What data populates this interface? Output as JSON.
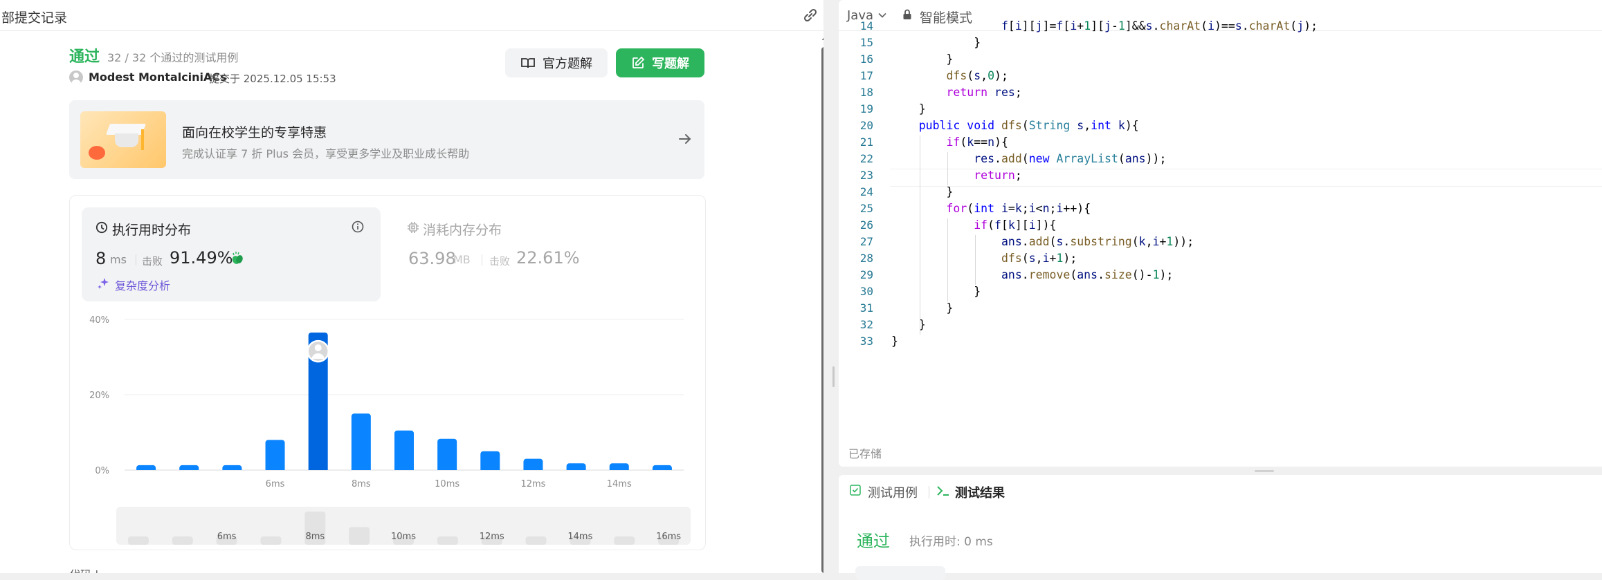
{
  "left_panel": {
    "title": "部提交记录",
    "status": "通过",
    "status_sub": "32 / 32 个通过的测试用例",
    "user_name": "Modest MontalciniACs",
    "submit_time": "提交于 2025.12.05 15:53",
    "btn_official": "官方题解",
    "btn_write": "写题解",
    "bottom_cut": "代码 | ..."
  },
  "promo": {
    "title": "面向在校学生的专享特惠",
    "subtitle": "完成认证享 7 折 Plus 会员，享受更多学业及职业成长帮助"
  },
  "runtime": {
    "title": "执行用时分布",
    "value": "8",
    "unit": "ms",
    "beat_label": "击败",
    "beat_pct": "91.49%",
    "complexity_link": "复杂度分析"
  },
  "memory": {
    "title": "消耗内存分布",
    "value": "63.98",
    "unit": "MB",
    "beat_label": "击败",
    "beat_pct": "22.61%"
  },
  "chart_data": {
    "type": "bar",
    "title": "",
    "xlabel": "",
    "ylabel": "",
    "ylim": [
      0,
      40
    ],
    "y_ticks": [
      "0%",
      "20%",
      "40%"
    ],
    "x_tick_labels": [
      {
        "index": 3,
        "label": "6ms"
      },
      {
        "index": 5,
        "label": "8ms"
      },
      {
        "index": 7,
        "label": "10ms"
      },
      {
        "index": 9,
        "label": "12ms"
      },
      {
        "index": 11,
        "label": "14ms"
      },
      {
        "index": 13,
        "label": "16ms"
      }
    ],
    "values": [
      1.3,
      1.3,
      1.3,
      8,
      36.5,
      15,
      10.5,
      8.3,
      5,
      3,
      1.8,
      1.8,
      1.3
    ],
    "highlight_index": 4,
    "grid": true,
    "accent": "#0a84ff",
    "accent_dark": "#0066e0",
    "mini_values": [
      1,
      1,
      1,
      1,
      5,
      2.5,
      1,
      1,
      1,
      1,
      1,
      1,
      1
    ],
    "mini_labels": [
      {
        "index": 2,
        "label": "6ms"
      },
      {
        "index": 4,
        "label": "8ms"
      },
      {
        "index": 6,
        "label": "10ms"
      },
      {
        "index": 8,
        "label": "12ms"
      },
      {
        "index": 10,
        "label": "14ms"
      },
      {
        "index": 12,
        "label": "16ms"
      }
    ]
  },
  "editor": {
    "language": "Java",
    "mode": "智能模式",
    "saved": "已存储",
    "current_line": 23,
    "lines": [
      {
        "n": "14",
        "html": "                f[i][j]=f[i+1][j-1]&&s.charAt(i)==s.charAt(j);"
      },
      {
        "n": "15",
        "html": "            }"
      },
      {
        "n": "16",
        "html": "        }"
      },
      {
        "n": "17",
        "html": "        dfs(s,0);"
      },
      {
        "n": "18",
        "html": "        return res;"
      },
      {
        "n": "19",
        "html": "    }"
      },
      {
        "n": "20",
        "html": "    public void dfs(String s,int k){"
      },
      {
        "n": "21",
        "html": "        if(k==n){"
      },
      {
        "n": "22",
        "html": "            res.add(new ArrayList(ans));"
      },
      {
        "n": "23",
        "html": "            return;"
      },
      {
        "n": "24",
        "html": "        }"
      },
      {
        "n": "25",
        "html": "        for(int i=k;i<n;i++){"
      },
      {
        "n": "26",
        "html": "            if(f[k][i]){"
      },
      {
        "n": "27",
        "html": "                ans.add(s.substring(k,i+1));"
      },
      {
        "n": "28",
        "html": "                dfs(s,i+1);"
      },
      {
        "n": "29",
        "html": "                ans.remove(ans.size()-1);"
      },
      {
        "n": "30",
        "html": "            }"
      },
      {
        "n": "31",
        "html": "        }"
      },
      {
        "n": "32",
        "html": "    }"
      },
      {
        "n": "33",
        "html": "}"
      }
    ]
  },
  "results": {
    "tab_cases": "测试用例",
    "tab_result": "测试结果",
    "status": "通过",
    "time": "执行用时: 0 ms"
  }
}
